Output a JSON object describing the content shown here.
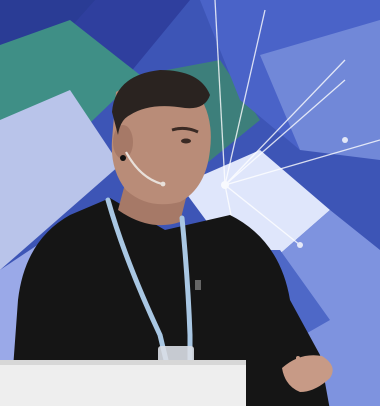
{
  "scene": {
    "subject": "speaker",
    "palette": {
      "backdrop_navy": "#2f3f9e",
      "backdrop_blue": "#4a63c8",
      "backdrop_teal": "#3f8f86",
      "backdrop_light": "#b9c4ea",
      "sweater": "#151515",
      "skin": "#b98c78",
      "hair": "#2a2320",
      "lanyard": "#a9c7e3",
      "podium": "#eeeeee"
    },
    "icons": [
      "headset-microphone-icon",
      "lanyard-icon",
      "podium-icon"
    ]
  }
}
